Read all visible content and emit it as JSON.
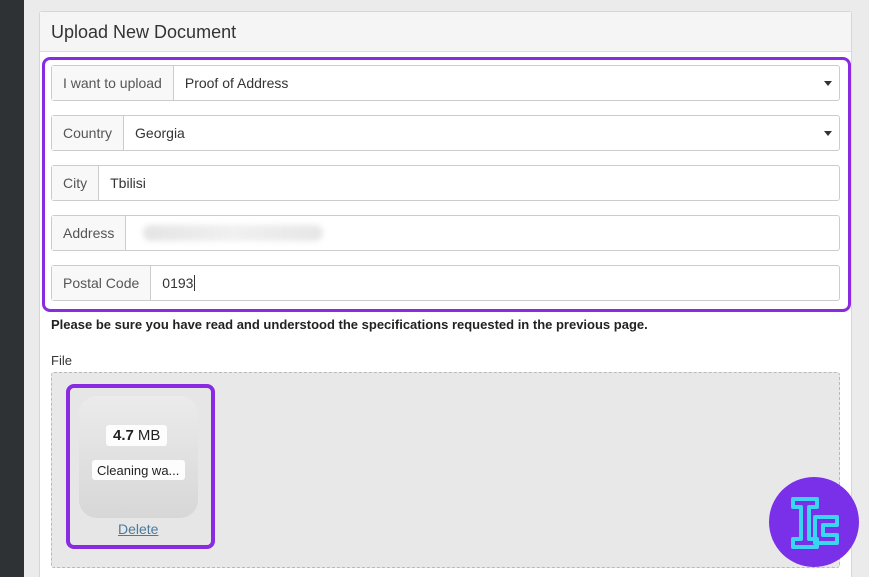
{
  "panel": {
    "title": "Upload New Document"
  },
  "form": {
    "upload_type": {
      "label": "I want to upload",
      "value": "Proof of Address"
    },
    "country": {
      "label": "Country",
      "value": "Georgia"
    },
    "city": {
      "label": "City",
      "value": "Tbilisi"
    },
    "address": {
      "label": "Address",
      "value": ""
    },
    "postal_code": {
      "label": "Postal Code",
      "value": "0193"
    }
  },
  "notice": "Please be sure you have read and understood the specifications requested in the previous page.",
  "file_section": {
    "label": "File",
    "file": {
      "size_number": "4.7",
      "size_unit": "MB",
      "name": "Cleaning wa...",
      "delete_label": "Delete"
    }
  },
  "colors": {
    "highlight": "#8a2be2",
    "logo_bg": "#7a2fe8",
    "logo_accent": "#3ad6f0"
  },
  "icons": {
    "select_caret": "chevron-down-icon",
    "brand_logo": "tc-logo-icon"
  }
}
